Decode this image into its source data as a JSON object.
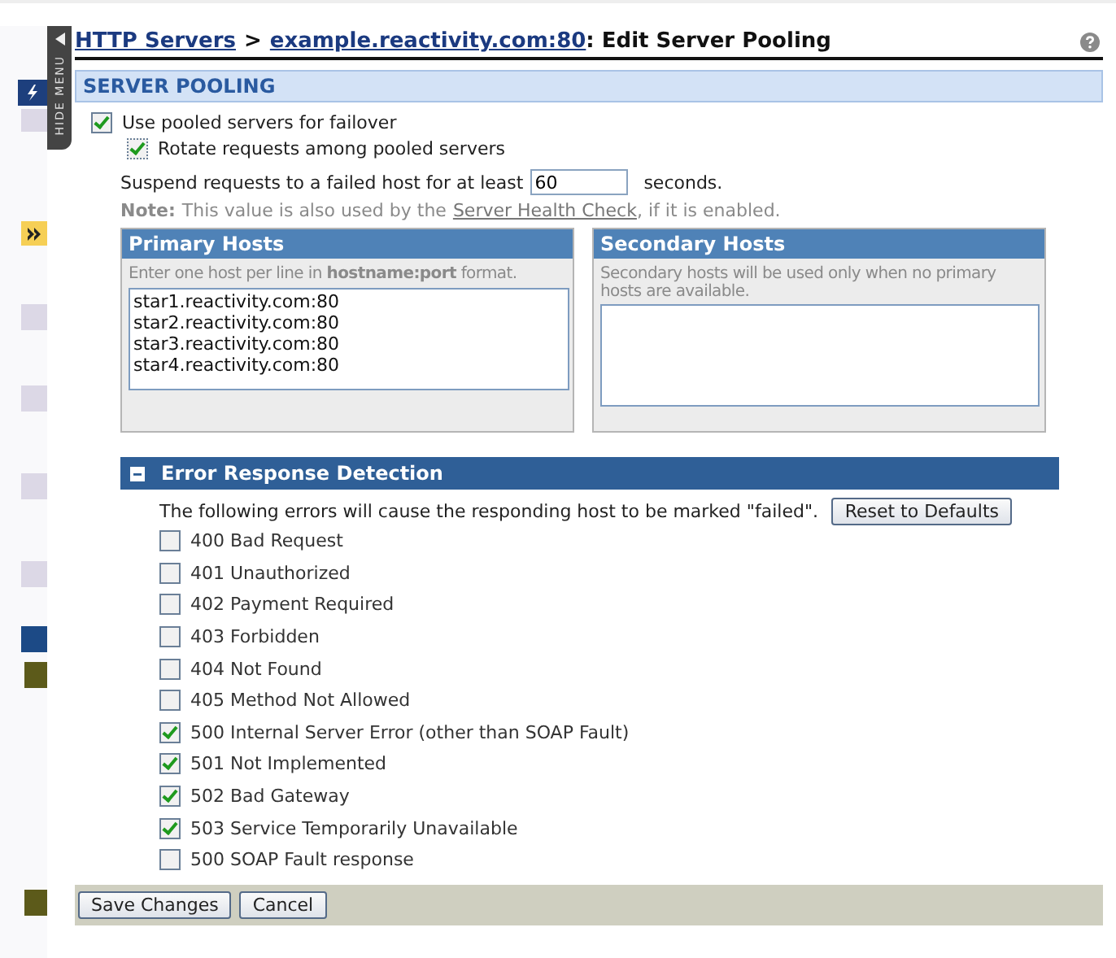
{
  "side_menu": {
    "toggle_label": "HIDE MENU"
  },
  "breadcrumb": {
    "items": [
      {
        "label": "HTTP Servers"
      },
      {
        "label": "example.reactivity.com:80"
      }
    ],
    "separator": ">",
    "current": ": Edit Server Pooling"
  },
  "section": {
    "title": "SERVER POOLING"
  },
  "pooling": {
    "use_pooled": {
      "label": "Use pooled servers for failover",
      "checked": true
    },
    "rotate": {
      "label": "Rotate requests among pooled servers",
      "checked": true
    },
    "suspend": {
      "before": "Suspend requests to a failed host for at least",
      "value": "60",
      "after": "seconds."
    },
    "note": {
      "label": "Note:",
      "before": "This value is also used by the",
      "link": "Server Health Check",
      "after": ", if it is enabled."
    }
  },
  "primary_hosts": {
    "title": "Primary Hosts",
    "hint": "Enter one host per line in **hostname:port** format.",
    "value": "star1.reactivity.com:80\nstar2.reactivity.com:80\nstar3.reactivity.com:80\nstar4.reactivity.com:80"
  },
  "secondary_hosts": {
    "title": "Secondary Hosts",
    "hint": "Secondary hosts will be used only when no primary hosts are available."
  },
  "error_detection": {
    "title": "Error Response Detection",
    "expanded": true,
    "description": "The following errors will cause the responding host to be marked \"failed\".",
    "reset_button": "Reset to Defaults",
    "errors": [
      {
        "label": "400 Bad Request",
        "checked": false
      },
      {
        "label": "401 Unauthorized",
        "checked": false
      },
      {
        "label": "402 Payment Required",
        "checked": false
      },
      {
        "label": "403 Forbidden",
        "checked": false
      },
      {
        "label": "404 Not Found",
        "checked": false
      },
      {
        "label": "405 Method Not Allowed",
        "checked": false
      },
      {
        "label": "500 Internal Server Error (other than SOAP Fault)",
        "checked": true
      },
      {
        "label": "501 Not Implemented",
        "checked": true
      },
      {
        "label": "502 Bad Gateway",
        "checked": true
      },
      {
        "label": "503 Service Temporarily Unavailable",
        "checked": true
      },
      {
        "label": "500 SOAP Fault response",
        "checked": false
      }
    ]
  },
  "buttons": [
    "Save Changes",
    "Cancel"
  ]
}
